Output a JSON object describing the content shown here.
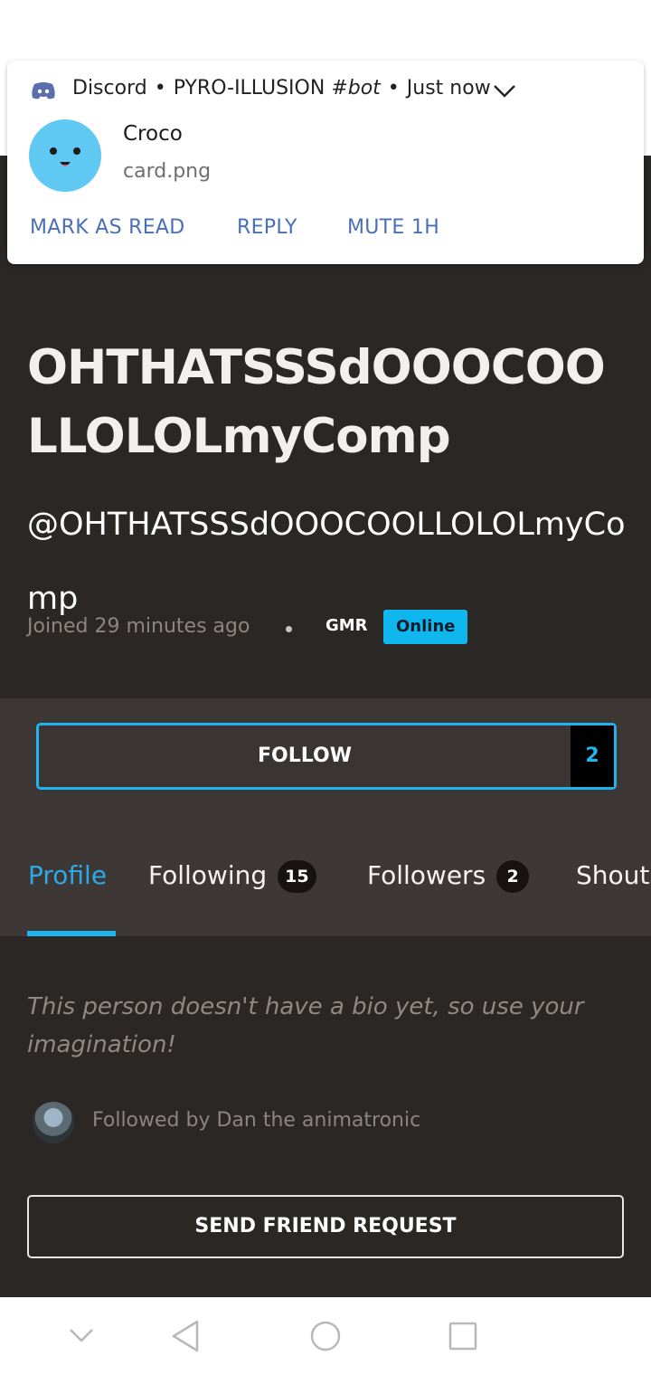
{
  "notification": {
    "app_name": "Discord",
    "channel_server": "PYRO-ILLUSION",
    "channel_name": "#bot",
    "time": "Just now",
    "title": "Croco",
    "body": "card.png",
    "actions": [
      "MARK AS READ",
      "REPLY",
      "MUTE 1H"
    ]
  },
  "profile": {
    "display_name": "OHTHATSSSdOOOCOOLLOLOLmyComp",
    "handle": "@OHTHATSSSdOOOCOOLLOLOLmyComp",
    "joined": "Joined 29 minutes ago",
    "rank_badge": "GMR",
    "status_badge": "Online"
  },
  "follow": {
    "label": "FOLLOW",
    "count": "2"
  },
  "tabs": [
    {
      "label": "Profile",
      "count": null,
      "active": true
    },
    {
      "label": "Following",
      "count": "15",
      "active": false
    },
    {
      "label": "Followers",
      "count": "2",
      "active": false
    },
    {
      "label": "Shouts",
      "count": null,
      "active": false
    }
  ],
  "bio": "This person doesn't have a bio yet, so use your imagination!",
  "followed_by": "Followed by Dan the animatronic",
  "friend_request_label": "SEND FRIEND REQUEST",
  "colors": {
    "accent": "#1eb5ee",
    "background": "#2b2725",
    "notification_action": "#4b6fb7"
  },
  "nav_icons": [
    "collapse-icon",
    "back-icon",
    "home-icon",
    "recents-icon"
  ]
}
